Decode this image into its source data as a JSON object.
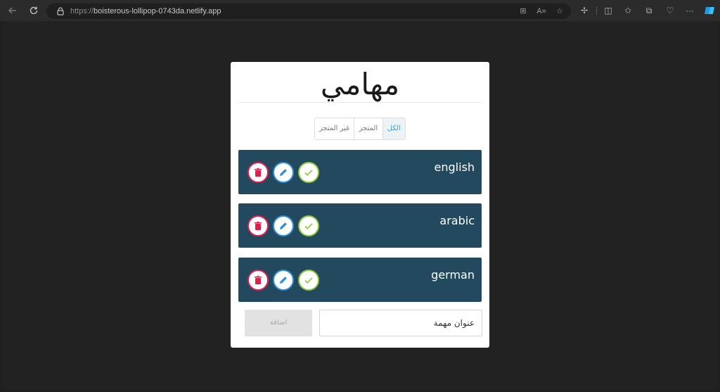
{
  "browser": {
    "url_scheme": "https://",
    "url_host": "boisterous-lollipop-0743da.netlify.app"
  },
  "app": {
    "title": "مهامي",
    "filters": [
      {
        "label": "الكل",
        "active": true
      },
      {
        "label": "المتجز",
        "active": false
      },
      {
        "label": "غير المتجز",
        "active": false
      }
    ],
    "tasks": [
      {
        "label": "english"
      },
      {
        "label": "arabic"
      },
      {
        "label": "german"
      }
    ],
    "add_button": "اضافة",
    "input_placeholder": "عنوان مهمة"
  },
  "colors": {
    "task_bg": "#22495d",
    "delete": "#e01f4d",
    "edit": "#2f8fd8",
    "done": "#8dc63f",
    "active_filter": "#3a9ad9"
  },
  "icons": {
    "delete": "trash-icon",
    "edit": "pencil-icon",
    "done": "check-icon"
  }
}
